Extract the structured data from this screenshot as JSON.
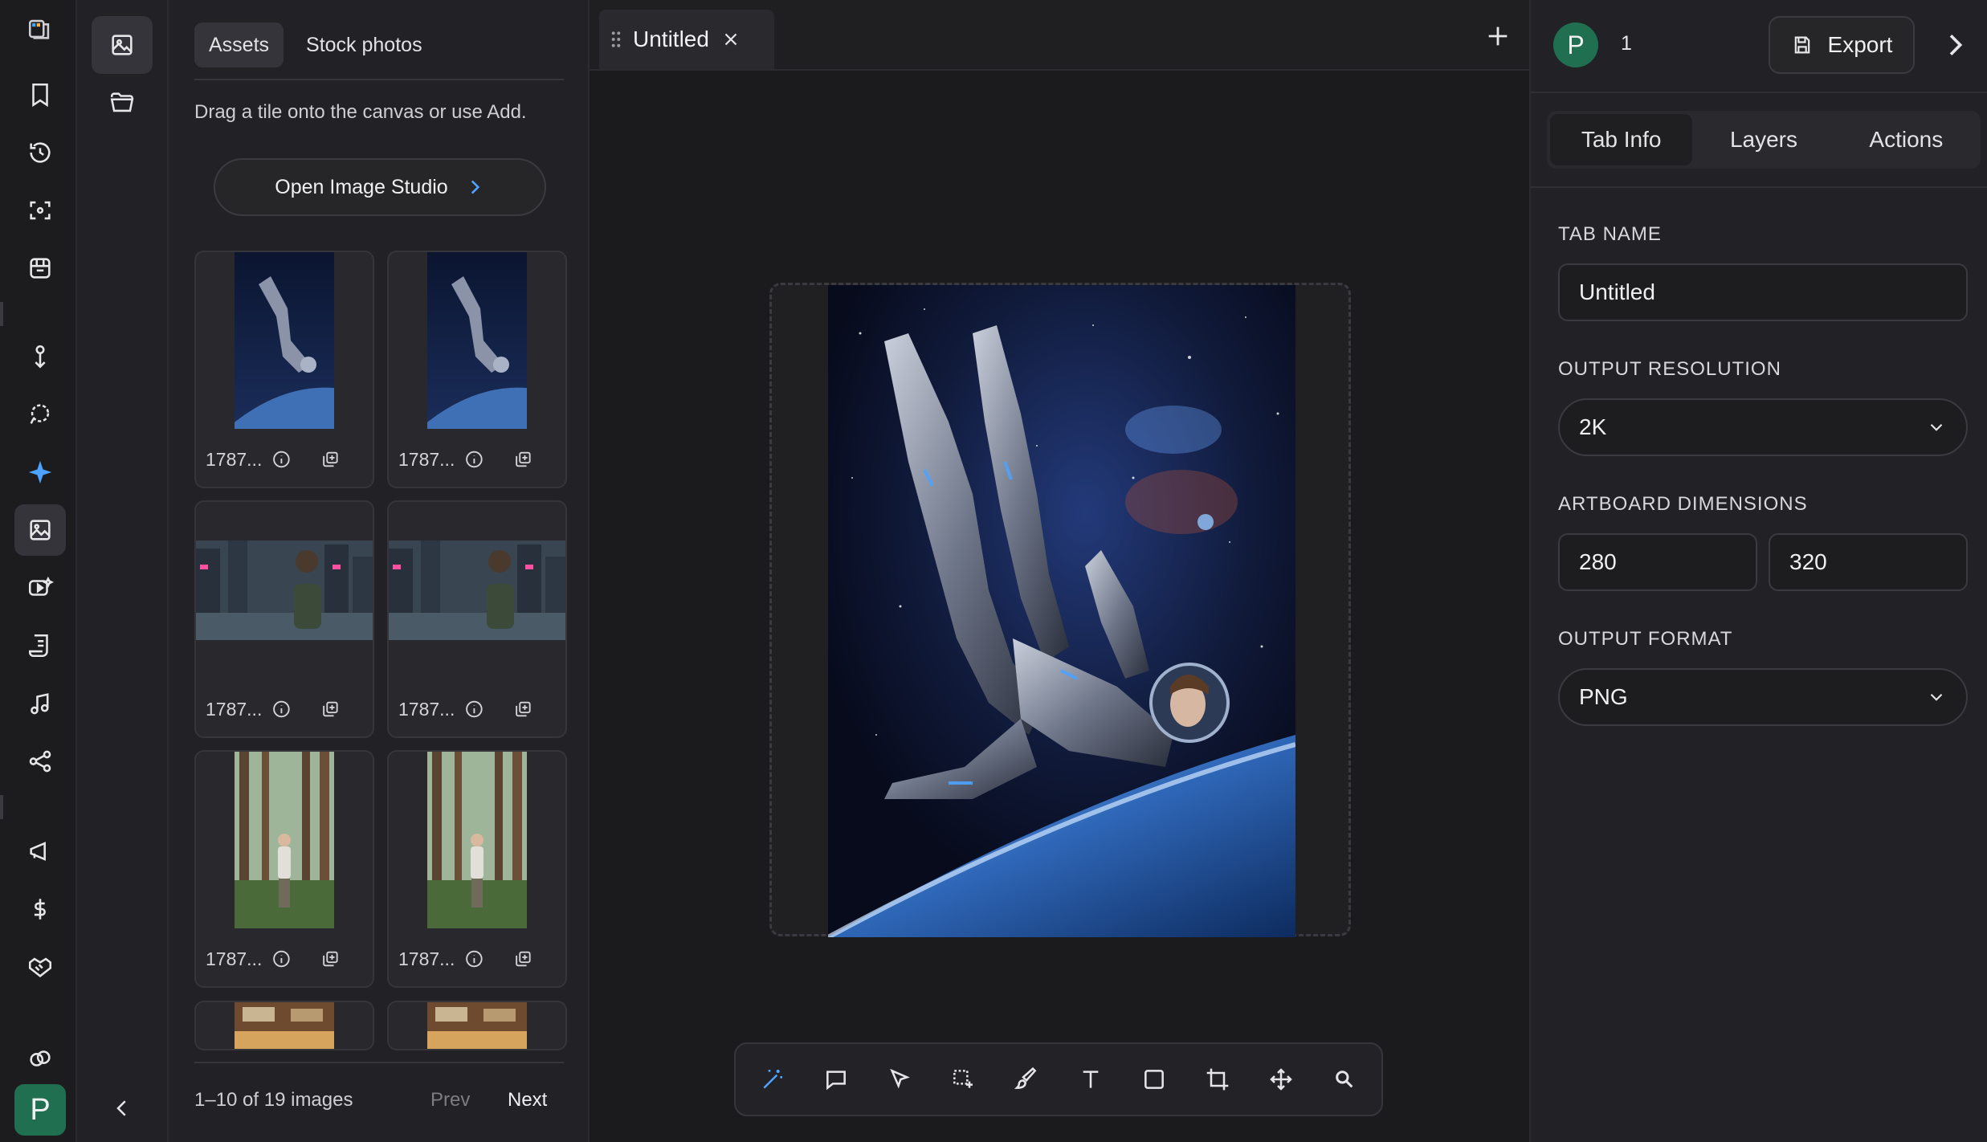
{
  "rail": {
    "items": [
      "logo-icon",
      "bookmark-icon",
      "history-icon",
      "focus-icon",
      "store-icon",
      "pin-icon",
      "lasso-icon",
      "sparkle-icon",
      "image-gallery-icon",
      "video-icon",
      "script-icon",
      "music-icon",
      "share-icon",
      "megaphone-icon",
      "dollar-icon",
      "handshake-icon",
      "link-icon"
    ],
    "avatar_initial": "P",
    "accent": "#4da3ff"
  },
  "side_nav": {
    "items": [
      "image-icon",
      "folder-icon"
    ],
    "collapse": "chevron-left-icon"
  },
  "assets": {
    "tabs": [
      {
        "label": "Assets",
        "active": true
      },
      {
        "label": "Stock photos",
        "active": false
      }
    ],
    "hint": "Drag a tile onto the canvas or use Add.",
    "studio_button": "Open Image Studio",
    "tiles": [
      {
        "name": "1787...",
        "kind": "astronaut"
      },
      {
        "name": "1787...",
        "kind": "astronaut"
      },
      {
        "name": "1787...",
        "kind": "city"
      },
      {
        "name": "1787...",
        "kind": "city"
      },
      {
        "name": "1787...",
        "kind": "forest"
      },
      {
        "name": "1787...",
        "kind": "forest"
      }
    ],
    "pager": {
      "count": "1–10 of 19 images",
      "prev": "Prev",
      "next": "Next"
    }
  },
  "canvas": {
    "tab_label": "Untitled",
    "tools": [
      "magic-wand-icon",
      "comment-icon",
      "pointer-icon",
      "select-add-icon",
      "brush-icon",
      "text-icon",
      "rectangle-icon",
      "crop-icon",
      "move-icon",
      "zoom-icon"
    ]
  },
  "right_panel": {
    "avatar_initial": "P",
    "user_count": "1",
    "export_label": "Export",
    "tabs": [
      {
        "label": "Tab Info",
        "active": true
      },
      {
        "label": "Layers",
        "active": false
      },
      {
        "label": "Actions",
        "active": false
      }
    ],
    "tab_name_label": "TAB NAME",
    "tab_name_value": "Untitled",
    "resolution_label": "OUTPUT RESOLUTION",
    "resolution_value": "2K",
    "dimensions_label": "ARTBOARD DIMENSIONS",
    "width_value": "280",
    "height_value": "320",
    "format_label": "OUTPUT FORMAT",
    "format_value": "PNG"
  }
}
